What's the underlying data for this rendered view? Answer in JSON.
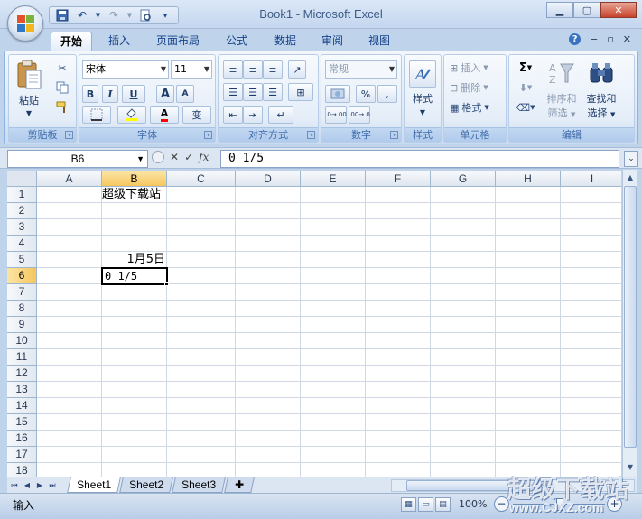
{
  "window": {
    "title": "Book1 - Microsoft Excel"
  },
  "ribbon": {
    "tabs": [
      "开始",
      "插入",
      "页面布局",
      "公式",
      "数据",
      "审阅",
      "视图"
    ],
    "active_tab": "开始",
    "clipboard": {
      "label": "剪贴板",
      "paste": "粘贴"
    },
    "font": {
      "label": "字体",
      "name": "宋体",
      "size": "11",
      "bold": "B",
      "italic": "I",
      "underline": "U",
      "grow": "A",
      "shrink": "A",
      "font_color": "A",
      "phonetic": "变"
    },
    "alignment": {
      "label": "对齐方式"
    },
    "number": {
      "label": "数字",
      "format": "常规",
      "percent": "%",
      "comma": ",",
      "inc_decimal": ".0→.00",
      "dec_decimal": ".00→.0"
    },
    "styles": {
      "label": "样式",
      "button": "样式"
    },
    "cells": {
      "label": "单元格",
      "insert": "插入",
      "delete": "删除",
      "format": "格式"
    },
    "editing": {
      "label": "编辑",
      "sort_filter_1": "排序和",
      "sort_filter_2": "筛选",
      "find_select_1": "查找和",
      "find_select_2": "选择",
      "sum": "Σ"
    }
  },
  "formula_bar": {
    "name_box": "B6",
    "formula": "0 1/5",
    "fx": "fx"
  },
  "grid": {
    "columns": [
      "A",
      "B",
      "C",
      "D",
      "E",
      "F",
      "G",
      "H",
      "I"
    ],
    "rows": [
      "1",
      "2",
      "3",
      "4",
      "5",
      "6",
      "7",
      "8",
      "9",
      "10",
      "11",
      "12",
      "13",
      "14",
      "15",
      "16",
      "17",
      "18"
    ],
    "selected_column": "B",
    "selected_row": "6",
    "cells": {
      "B1": "超级下载站",
      "B5": "1月5日",
      "B6": "0 1/5"
    }
  },
  "sheets": [
    "Sheet1",
    "Sheet2",
    "Sheet3"
  ],
  "active_sheet": "Sheet1",
  "status": {
    "mode": "输入",
    "zoom": "100%"
  },
  "watermark": {
    "title": "超级下载站",
    "url": "www.CJXZ.com"
  }
}
